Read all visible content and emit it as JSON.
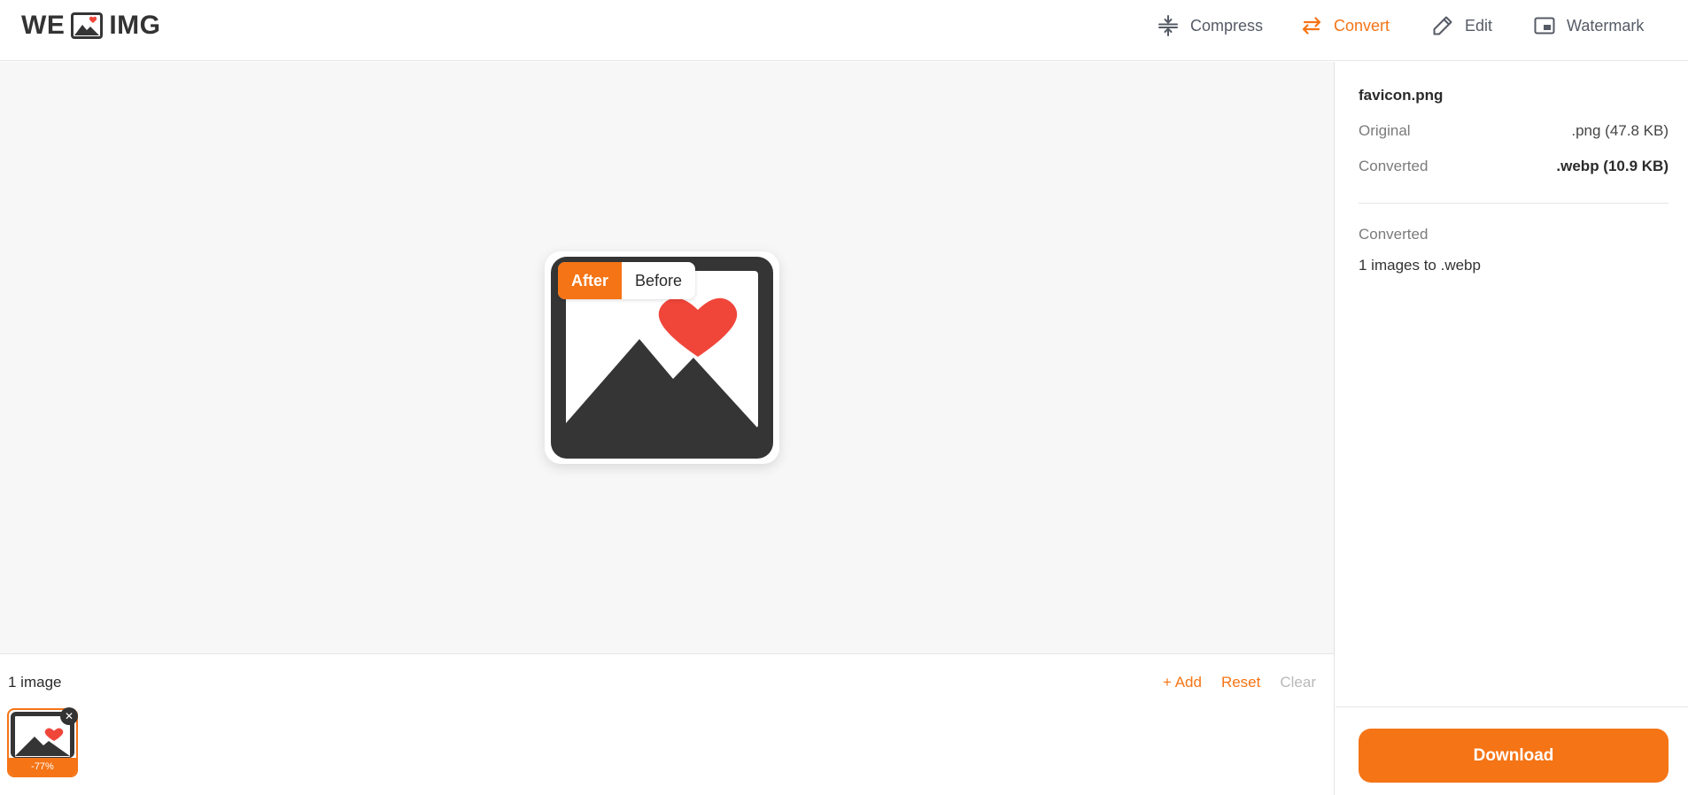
{
  "brand": {
    "left": "WE",
    "right": "IMG",
    "accent": "#f57415",
    "heart": "#f0463a",
    "dark": "#353535"
  },
  "nav": [
    {
      "label": "Compress",
      "icon": "compress-icon",
      "active": false
    },
    {
      "label": "Convert",
      "icon": "convert-arrows-icon",
      "active": true
    },
    {
      "label": "Edit",
      "icon": "pencil-icon",
      "active": false
    },
    {
      "label": "Watermark",
      "icon": "watermark-icon",
      "active": false
    }
  ],
  "preview": {
    "toggle": {
      "after": "After",
      "before": "Before",
      "selected": "After"
    }
  },
  "strip": {
    "count": "1 image",
    "add": "+ Add",
    "reset": "Reset",
    "clear": "Clear",
    "thumb_badge": "-77%",
    "thumb_close": "✕"
  },
  "sidebar": {
    "file_name": "favicon.png",
    "original_label": "Original",
    "original_value": ".png (47.8 KB)",
    "converted_label": "Converted",
    "converted_value": ".webp (10.9 KB)",
    "summary_label": "Converted",
    "summary_value": "1 images to .webp",
    "download": "Download"
  }
}
